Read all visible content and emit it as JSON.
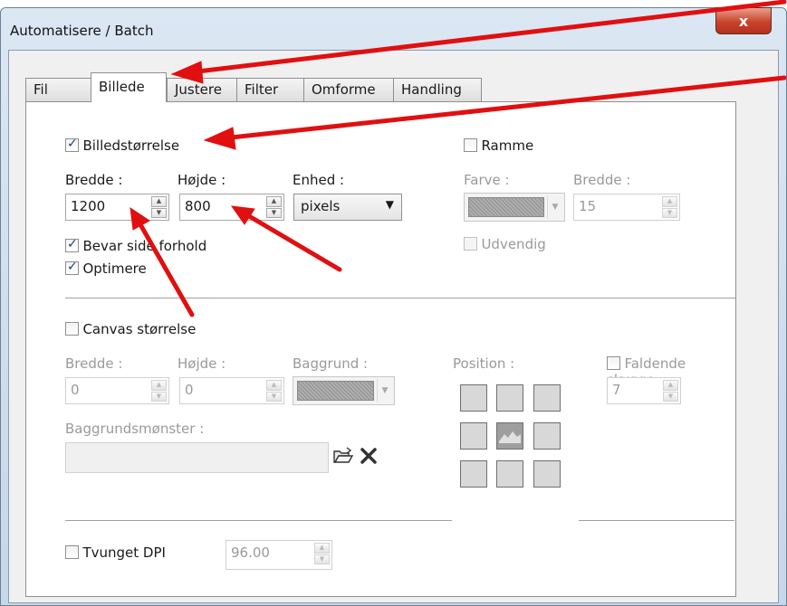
{
  "window": {
    "title": "Automatisere / Batch",
    "close_label": "x"
  },
  "tabs": [
    {
      "label": "Fil"
    },
    {
      "label": "Billede",
      "active": true
    },
    {
      "label": "Justere"
    },
    {
      "label": "Filter"
    },
    {
      "label": "Omforme"
    },
    {
      "label": "Handling"
    }
  ],
  "image_size": {
    "checkbox_label": "Billedstørrelse",
    "checked": true,
    "width_label": "Bredde :",
    "width_value": "1200",
    "height_label": "Højde :",
    "height_value": "800",
    "unit_label": "Enhed :",
    "unit_value": "pixels",
    "keep_ratio_label": "Bevar side forhold",
    "keep_ratio_checked": true,
    "optimize_label": "Optimere",
    "optimize_checked": true
  },
  "frame": {
    "checkbox_label": "Ramme",
    "checked": false,
    "color_label": "Farve :",
    "width_label": "Bredde :",
    "width_value": "15",
    "outside_label": "Udvendig"
  },
  "canvas": {
    "checkbox_label": "Canvas størrelse",
    "checked": false,
    "width_label": "Bredde :",
    "width_value": "0",
    "height_label": "Højde :",
    "height_value": "0",
    "background_label": "Baggrund :",
    "position_label": "Position :",
    "pattern_label": "Baggrundsmønster :",
    "pattern_value": ""
  },
  "shadow": {
    "checkbox_label": "Faldende skygge",
    "value": "7"
  },
  "dpi": {
    "checkbox_label": "Tvunget DPI",
    "value": "96.00"
  },
  "colors": {
    "annotation_arrow": "#e01010",
    "checkbox_tick": "#1f3f86",
    "close_button": "#c9432a"
  }
}
